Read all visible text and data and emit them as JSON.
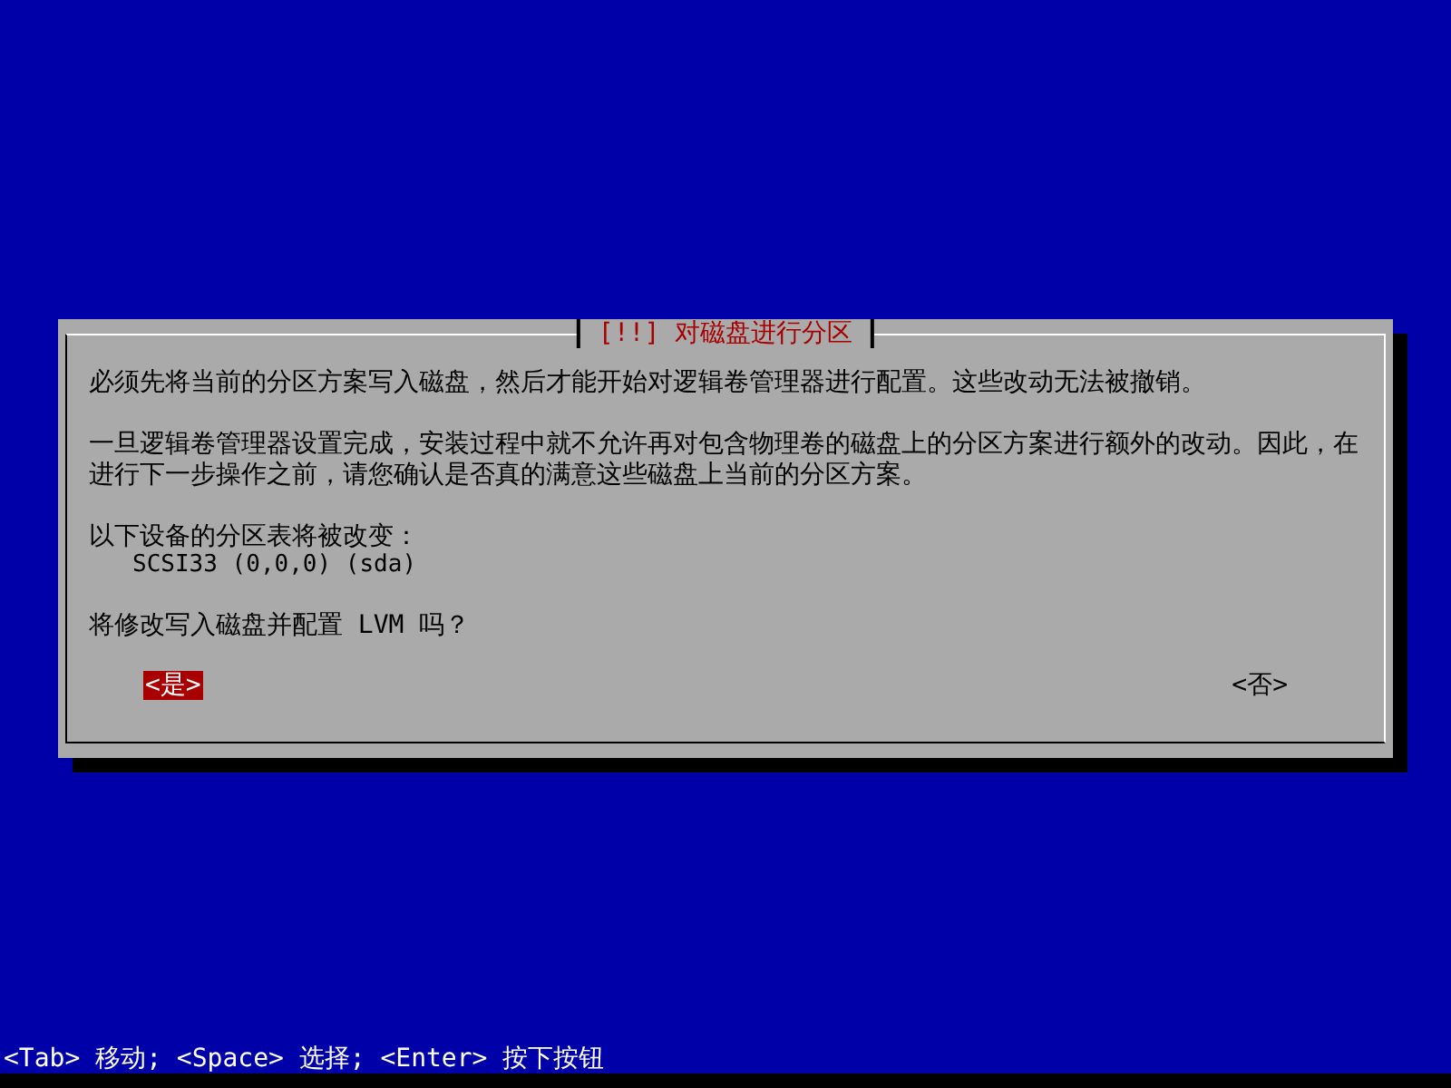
{
  "dialog": {
    "title": "[!!] 对磁盘进行分区",
    "paragraphs": [
      "必须先将当前的分区方案写入磁盘，然后才能开始对逻辑卷管理器进行配置。这些改动无法被撤销。",
      "一旦逻辑卷管理器设置完成，安装过程中就不允许再对包含物理卷的磁盘上的分区方案进行额外的改动。因此，在进行下一步操作之前，请您确认是否真的满意这些磁盘上当前的分区方案。"
    ],
    "devices_label": "以下设备的分区表将被改变：",
    "devices": [
      "SCSI33 (0,0,0) (sda)"
    ],
    "question": "将修改写入磁盘并配置 LVM 吗？",
    "buttons": [
      {
        "label": "<是>",
        "selected": true
      },
      {
        "label": "<否>",
        "selected": false
      }
    ]
  },
  "status_bar": "<Tab> 移动; <Space> 选择; <Enter> 按下按钮"
}
